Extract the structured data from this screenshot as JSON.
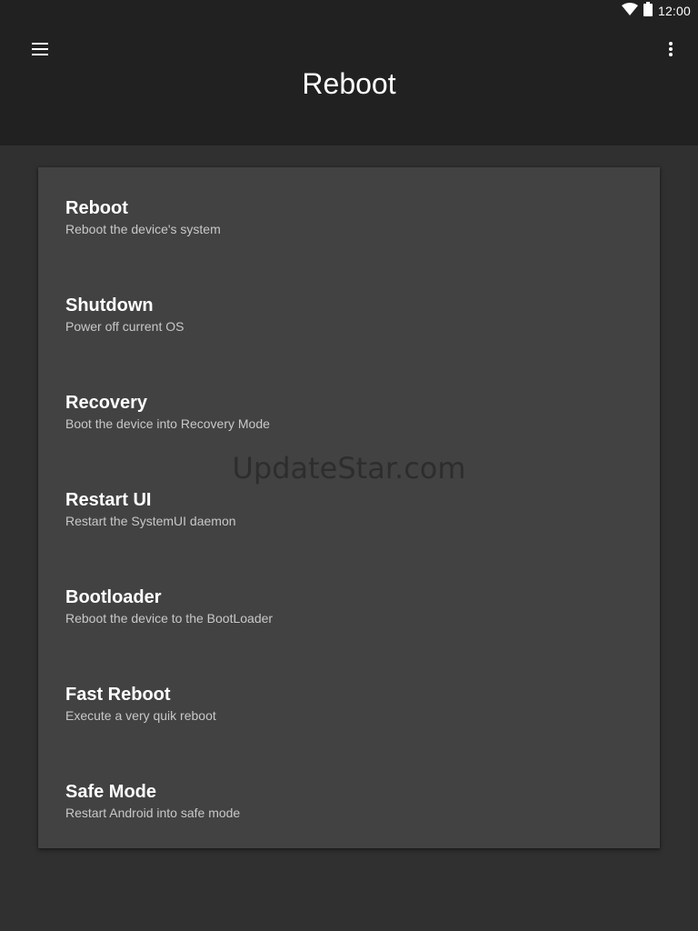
{
  "status_bar": {
    "time": "12:00",
    "icons": [
      "wifi-icon",
      "battery-icon"
    ]
  },
  "app_bar": {
    "title": "Reboot",
    "menu_icon": "hamburger-menu-icon",
    "overflow_icon": "more-vert-icon"
  },
  "options": [
    {
      "title": "Reboot",
      "description": "Reboot the device's system"
    },
    {
      "title": "Shutdown",
      "description": "Power off current OS"
    },
    {
      "title": "Recovery",
      "description": "Boot the device into Recovery Mode"
    },
    {
      "title": "Restart UI",
      "description": "Restart the SystemUI daemon"
    },
    {
      "title": "Bootloader",
      "description": "Reboot the device to the BootLoader"
    },
    {
      "title": "Fast Reboot",
      "description": "Execute a very quik reboot"
    },
    {
      "title": "Safe Mode",
      "description": "Restart Android into safe mode"
    }
  ],
  "watermark": "UpdateStar.com",
  "colors": {
    "background": "#303030",
    "app_bar": "#212121",
    "card": "#424242",
    "title_text": "#ffffff",
    "description_text": "#c8c8c8"
  }
}
